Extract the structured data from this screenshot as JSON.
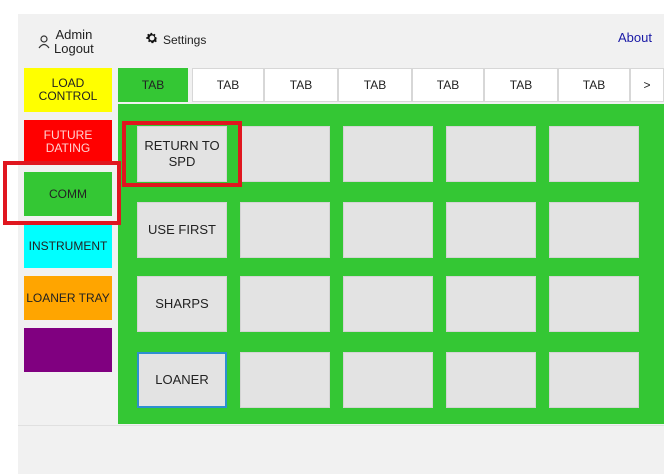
{
  "header": {
    "user_name": "Admin",
    "logout_label": "Logout",
    "settings_label": "Settings",
    "about_label": "About"
  },
  "sidebar": {
    "items": [
      {
        "label": "LOAD CONTROL",
        "color": "#ffff00"
      },
      {
        "label": "FUTURE DATING",
        "color": "#ff0000"
      },
      {
        "label": "COMM",
        "color": "#34c734"
      },
      {
        "label": "INSTRUMENT",
        "color": "#00ffff"
      },
      {
        "label": "LOANER TRAY",
        "color": "#ffa500"
      },
      {
        "label": "",
        "color": "#800080"
      }
    ]
  },
  "tabs": {
    "items": [
      "TAB",
      "TAB",
      "TAB",
      "TAB",
      "TAB",
      "TAB",
      "TAB"
    ],
    "active_index": 0,
    "more_label": ">"
  },
  "grid": {
    "rows": [
      [
        "RETURN TO SPD",
        "",
        "",
        "",
        ""
      ],
      [
        "USE FIRST",
        "",
        "",
        "",
        ""
      ],
      [
        "SHARPS",
        "",
        "",
        "",
        ""
      ],
      [
        "LOANER",
        "",
        "",
        "",
        ""
      ]
    ],
    "selected": "LOANER"
  },
  "colors": {
    "accent_green": "#34c734",
    "highlight_red": "#e0161f",
    "link_blue": "#1a1aa6"
  }
}
